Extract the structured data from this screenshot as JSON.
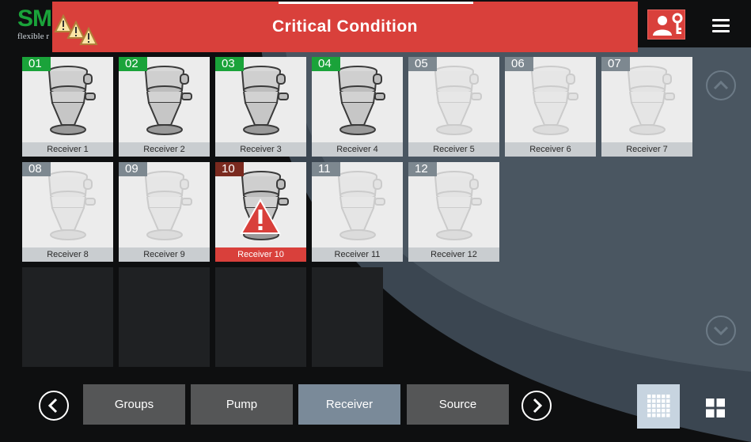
{
  "logo": {
    "mark": "SM",
    "tagline": "flexible r"
  },
  "header": {
    "title": "Critical Condition",
    "warning_icon": "triple-warning-icon",
    "user_key_icon": "user-key-icon",
    "menu_icon": "hamburger-menu-icon"
  },
  "colors": {
    "alarm": "#d9403b",
    "ok": "#1aa33a",
    "inactive": "#7d8890",
    "error_badge": "#7a2a1f",
    "active_tab": "#7a8a99",
    "tab": "#555657"
  },
  "receivers": [
    {
      "num": "01",
      "label": "Receiver 1",
      "state": "ok"
    },
    {
      "num": "02",
      "label": "Receiver 2",
      "state": "ok"
    },
    {
      "num": "03",
      "label": "Receiver 3",
      "state": "ok"
    },
    {
      "num": "04",
      "label": "Receiver 4",
      "state": "ok"
    },
    {
      "num": "05",
      "label": "Receiver 5",
      "state": "off"
    },
    {
      "num": "06",
      "label": "Receiver 6",
      "state": "off"
    },
    {
      "num": "07",
      "label": "Receiver 7",
      "state": "off"
    },
    {
      "num": "08",
      "label": "Receiver 8",
      "state": "off"
    },
    {
      "num": "09",
      "label": "Receiver 9",
      "state": "off"
    },
    {
      "num": "10",
      "label": "Receiver 10",
      "state": "err"
    },
    {
      "num": "11",
      "label": "Receiver 11",
      "state": "off"
    },
    {
      "num": "12",
      "label": "Receiver 12",
      "state": "off"
    }
  ],
  "scroll": {
    "up_icon": "chevron-up-icon",
    "down_icon": "chevron-down-icon"
  },
  "nav": {
    "prev_icon": "chevron-left-icon",
    "next_icon": "chevron-right-icon",
    "tabs": [
      {
        "label": "Groups",
        "active": false
      },
      {
        "label": "Pump",
        "active": false
      },
      {
        "label": "Receiver",
        "active": true
      },
      {
        "label": "Source",
        "active": false
      }
    ],
    "grid_view_icon": "grid-small-icon",
    "tile_view_icon": "grid-large-icon"
  }
}
